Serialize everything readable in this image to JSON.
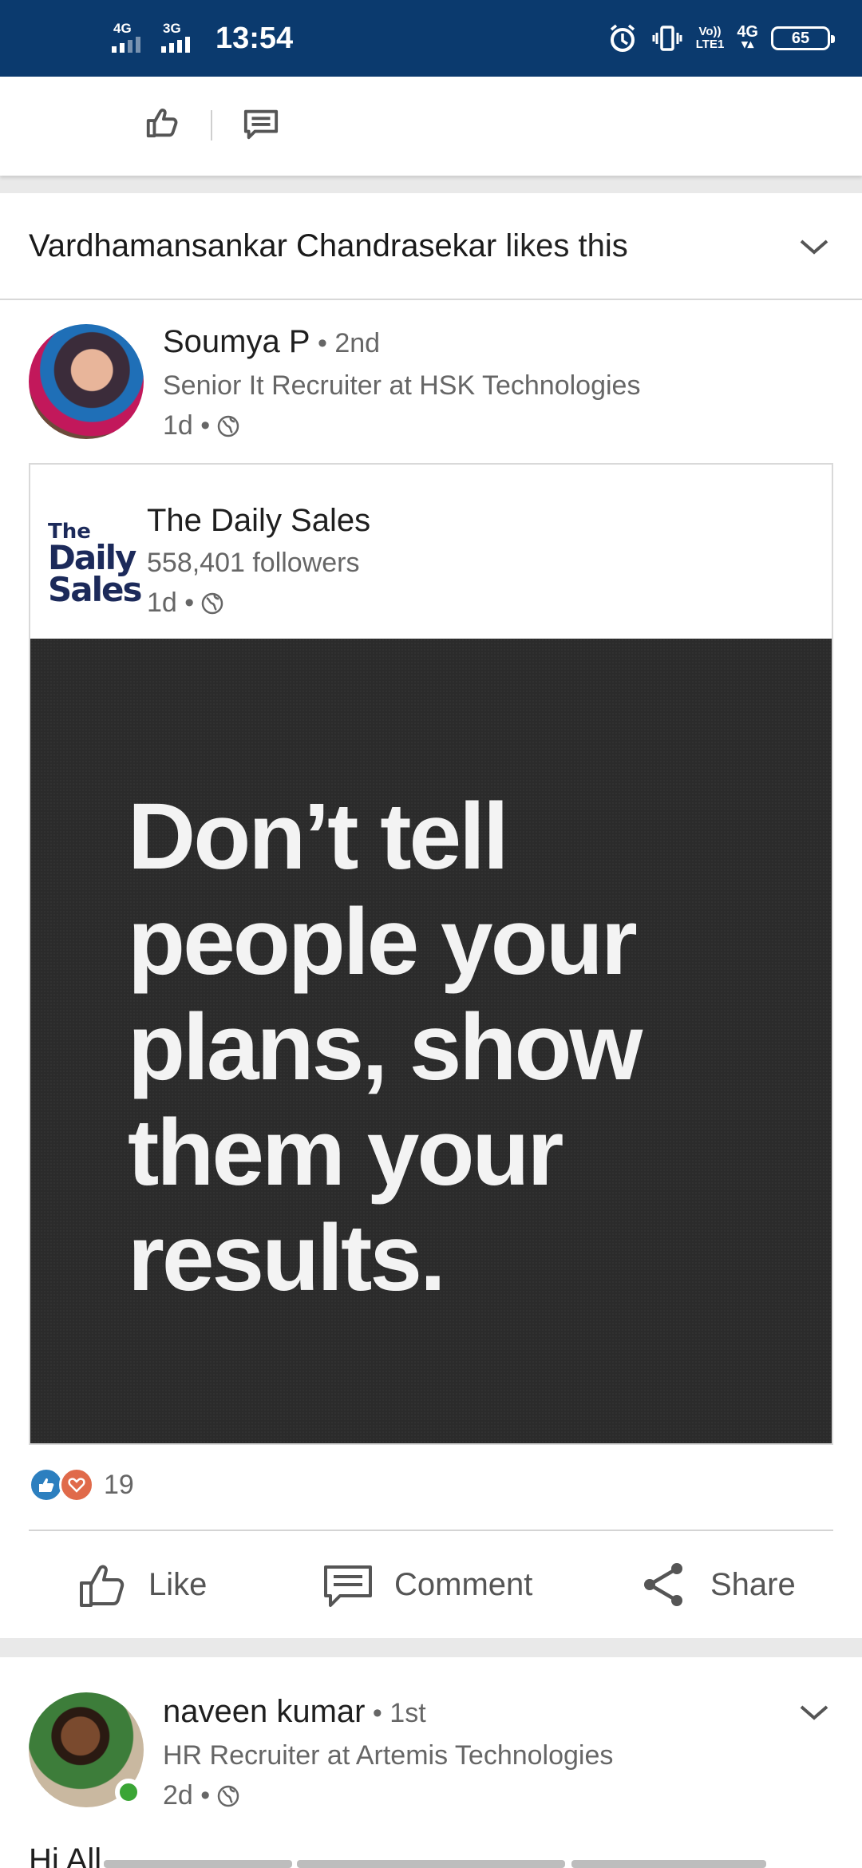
{
  "status_bar": {
    "net1": "4G",
    "net2": "3G",
    "time": "13:54",
    "volte_top": "Vo))",
    "volte_bottom": "LTE1",
    "net3": "4G",
    "battery": "65"
  },
  "feed": {
    "liked_by_name": "Vardhamansankar Chandrasekar",
    "liked_by_suffix": " likes this",
    "post": {
      "author_name": "Soumya P",
      "author_degree": " • 2nd",
      "author_headline": "Senior It Recruiter at HSK Technologies",
      "time": "1d •",
      "shared": {
        "logo_the": "The",
        "logo_daily": "Daily",
        "logo_sales": "Sales",
        "page_name": "The Daily Sales",
        "followers": "558,401 followers",
        "time": "1d •",
        "quote": "Don’t tell people your plans, show them your results."
      },
      "reaction_count": "19",
      "actions": {
        "like": "Like",
        "comment": "Comment",
        "share": "Share"
      }
    },
    "next_post": {
      "author_name": "naveen kumar",
      "author_degree": " • 1st",
      "author_headline": "HR Recruiter at Artemis Technologies",
      "time": "2d •",
      "text": "Hi All"
    }
  }
}
